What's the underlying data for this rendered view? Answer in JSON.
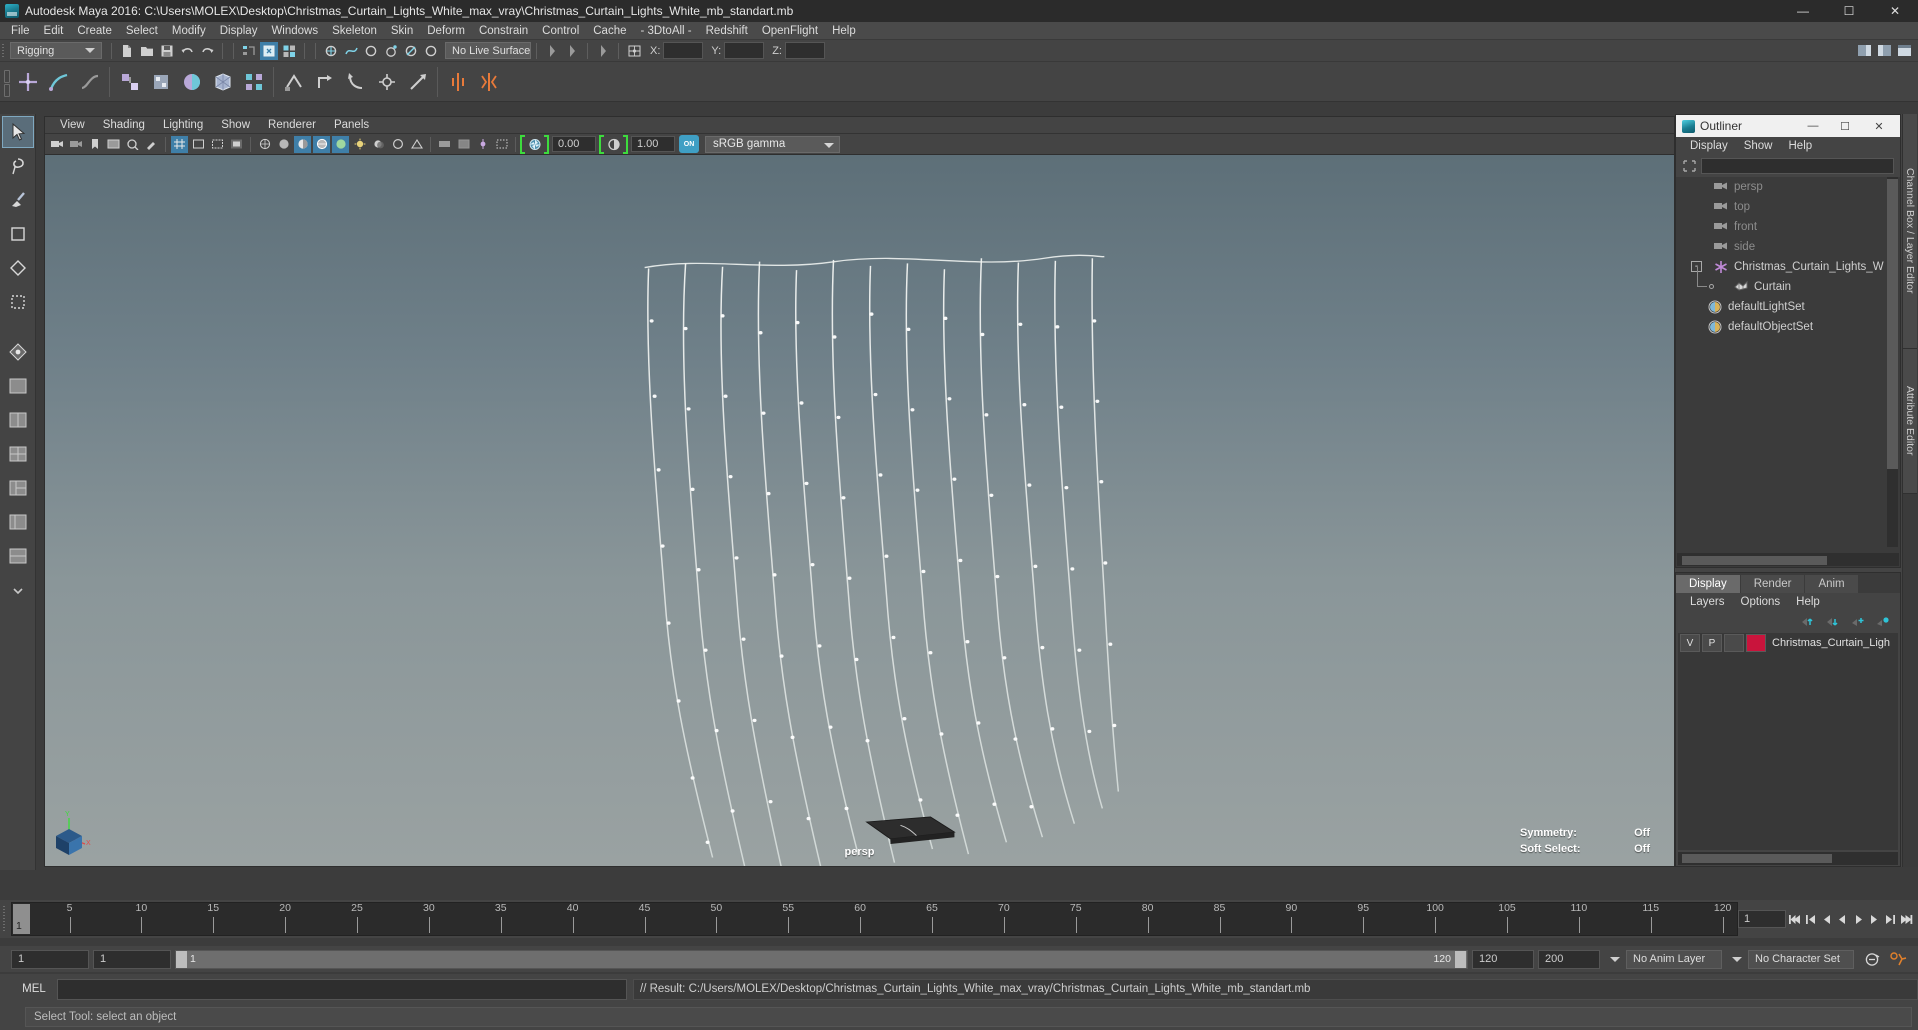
{
  "window": {
    "title": "Autodesk Maya 2016: C:\\Users\\MOLEX\\Desktop\\Christmas_Curtain_Lights_White_max_vray\\Christmas_Curtain_Lights_White_mb_standart.mb",
    "minimize": "—",
    "maximize": "☐",
    "close": "✕"
  },
  "menubar": {
    "items": [
      "File",
      "Edit",
      "Create",
      "Select",
      "Modify",
      "Display",
      "Windows",
      "Skeleton",
      "Skin",
      "Deform",
      "Constrain",
      "Control",
      "Cache",
      "- 3DtoAll -",
      "Redshift",
      "OpenFlight",
      "Help"
    ]
  },
  "statusline": {
    "menuset": "Rigging",
    "live_surface": "No Live Surface",
    "x_label": "X:",
    "y_label": "Y:",
    "z_label": "Z:",
    "x_value": "",
    "y_value": "",
    "z_value": ""
  },
  "panel_menu": {
    "items": [
      "View",
      "Shading",
      "Lighting",
      "Show",
      "Renderer",
      "Panels"
    ]
  },
  "view_toolbar": {
    "exposure_value": "0.00",
    "gamma_value": "1.00",
    "color_mgmt_toggle": "ON",
    "view_transform": "sRGB gamma"
  },
  "viewport": {
    "camera_label": "persp",
    "hud": [
      {
        "label": "Symmetry:",
        "value": "Off"
      },
      {
        "label": "Soft Select:",
        "value": "Off"
      }
    ],
    "axis": {
      "y": "Y",
      "x": "X",
      "z": "Z"
    }
  },
  "outliner": {
    "title": "Outliner",
    "window_buttons": {
      "minimize": "—",
      "maximize": "☐",
      "close": "✕"
    },
    "menu": [
      "Display",
      "Show",
      "Help"
    ],
    "search_value": "",
    "items": [
      {
        "label": "persp",
        "icon": "camera-icon",
        "dim": true,
        "indent": 0,
        "expander": ""
      },
      {
        "label": "top",
        "icon": "camera-icon",
        "dim": true,
        "indent": 0,
        "expander": ""
      },
      {
        "label": "front",
        "icon": "camera-icon",
        "dim": true,
        "indent": 0,
        "expander": ""
      },
      {
        "label": "side",
        "icon": "camera-icon",
        "dim": true,
        "indent": 0,
        "expander": ""
      },
      {
        "label": "Christmas_Curtain_Lights_W",
        "icon": "transform-icon",
        "dim": false,
        "indent": 0,
        "expander": "-"
      },
      {
        "label": "Curtain",
        "icon": "mesh-icon",
        "dim": false,
        "indent": 1,
        "expander": ""
      },
      {
        "label": "defaultLightSet",
        "icon": "set-icon",
        "dim": false,
        "indent": 0,
        "expander": ""
      },
      {
        "label": "defaultObjectSet",
        "icon": "set-icon",
        "dim": false,
        "indent": 0,
        "expander": ""
      }
    ]
  },
  "layer_editor": {
    "tabs": [
      {
        "label": "Display",
        "active": true
      },
      {
        "label": "Render",
        "active": false
      },
      {
        "label": "Anim",
        "active": false
      }
    ],
    "menu": [
      "Layers",
      "Options",
      "Help"
    ],
    "columns": {
      "v": "V",
      "p": "P"
    },
    "layer_color": "#c9143c",
    "rows": [
      {
        "v": "V",
        "p": "P",
        "name": "Christmas_Curtain_Ligh"
      }
    ]
  },
  "right_tabs": [
    "Channel Box / Layer Editor",
    "Attribute Editor"
  ],
  "timeline": {
    "current_frame": "1",
    "ticks": [
      {
        "label": "5",
        "frame": 5
      },
      {
        "label": "10",
        "frame": 10
      },
      {
        "label": "15",
        "frame": 15
      },
      {
        "label": "20",
        "frame": 20
      },
      {
        "label": "25",
        "frame": 25
      },
      {
        "label": "30",
        "frame": 30
      },
      {
        "label": "35",
        "frame": 35
      },
      {
        "label": "40",
        "frame": 40
      },
      {
        "label": "45",
        "frame": 45
      },
      {
        "label": "50",
        "frame": 50
      },
      {
        "label": "55",
        "frame": 55
      },
      {
        "label": "60",
        "frame": 60
      },
      {
        "label": "65",
        "frame": 65
      },
      {
        "label": "70",
        "frame": 70
      },
      {
        "label": "75",
        "frame": 75
      },
      {
        "label": "80",
        "frame": 80
      },
      {
        "label": "85",
        "frame": 85
      },
      {
        "label": "90",
        "frame": 90
      },
      {
        "label": "95",
        "frame": 95
      },
      {
        "label": "100",
        "frame": 100
      },
      {
        "label": "105",
        "frame": 105
      },
      {
        "label": "110",
        "frame": 110
      },
      {
        "label": "115",
        "frame": 115
      },
      {
        "label": "120",
        "frame": 120
      }
    ],
    "range_start": 1,
    "range_end": 120,
    "playback_key": "1"
  },
  "range_slider": {
    "anim_start": "1",
    "range_start": "1",
    "range_bar_min": "1",
    "range_bar_max": "120",
    "range_end": "120",
    "anim_end": "200",
    "anim_layer": "No Anim Layer",
    "character_set": "No Character Set"
  },
  "command_line": {
    "label": "MEL",
    "input_value": "",
    "result": "// Result: C:/Users/MOLEX/Desktop/Christmas_Curtain_Lights_White_max_vray/Christmas_Curtain_Lights_White_mb_standart.mb"
  },
  "help_line": {
    "text": "Select Tool: select an object"
  },
  "colors": {
    "accent_blue": "#3f7fa8",
    "green_bracket": "#3ddc3d",
    "layer_red": "#c9143c",
    "titlebar": "#2b2b2b",
    "panel": "#444444"
  }
}
